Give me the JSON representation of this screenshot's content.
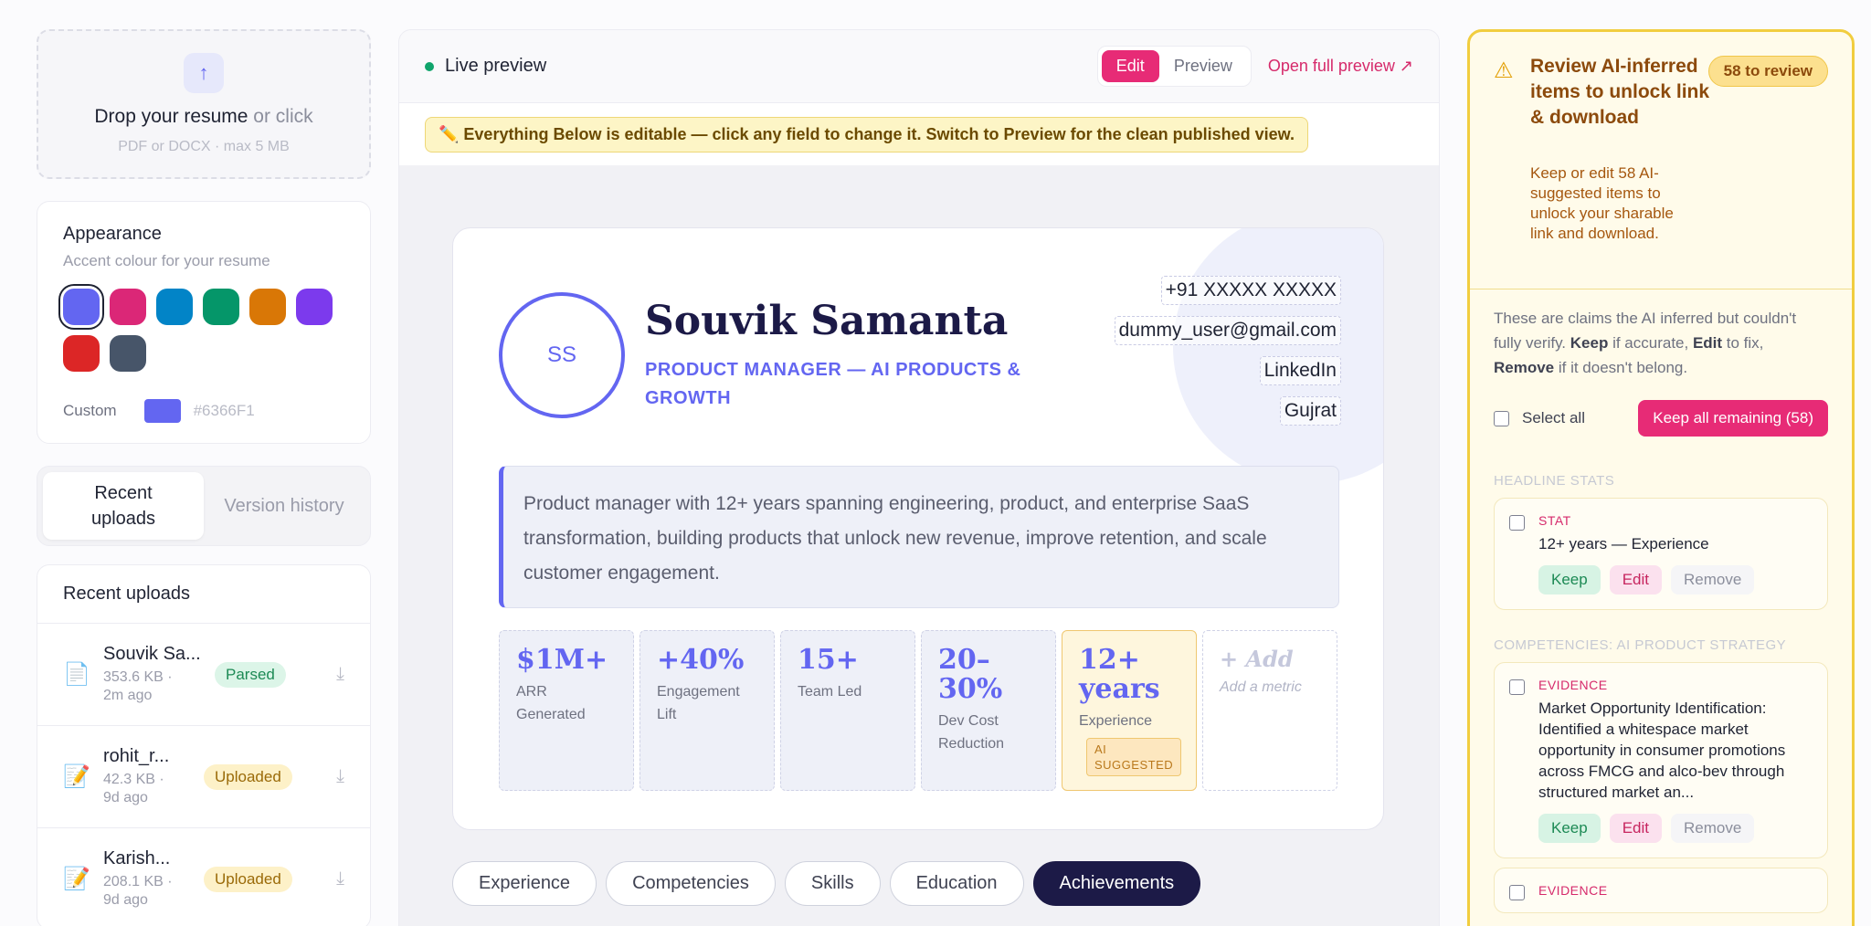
{
  "upload": {
    "icon": "arrow-up-icon",
    "title": "Drop your resume",
    "title_suffix": " or click",
    "subtitle": "PDF or DOCX · max 5 MB"
  },
  "appearance": {
    "title": "Appearance",
    "subtitle": "Accent colour for your resume",
    "swatches": [
      "#6366F1",
      "#DB2777",
      "#0284C7",
      "#059669",
      "#D97706",
      "#7C3AED",
      "#DC2626",
      "#475569"
    ],
    "selected": "#6366F1",
    "custom_label": "Custom",
    "custom_value": "#6366F1"
  },
  "side_tabs": [
    {
      "label": "Recent\nuploads",
      "active": true
    },
    {
      "label": "Version history",
      "active": false
    }
  ],
  "uploads": {
    "title": "Recent uploads",
    "items": [
      {
        "name": "Souvik Sa...",
        "size": "353.6 KB ·",
        "time": "2m ago",
        "status": "Parsed"
      },
      {
        "name": "rohit_r...",
        "size": "42.3 KB ·",
        "time": "9d ago",
        "status": "Uploaded"
      },
      {
        "name": "Karish...",
        "size": "208.1 KB ·",
        "time": "9d ago",
        "status": "Uploaded"
      }
    ]
  },
  "preview_bar": {
    "live_label": "Live preview",
    "edit_label": "Edit",
    "preview_label": "Preview",
    "open_full_label": "Open full preview ↗"
  },
  "notice": "✏️ Everything Below is editable — click any field to change it. Switch to Preview for the clean published view.",
  "resume": {
    "initials": "SS",
    "name": "Souvik Samanta",
    "title": "PRODUCT MANAGER — AI PRODUCTS & GROWTH",
    "contacts": [
      "+91 XXXXX XXXXX",
      "dummy_user@gmail.com",
      "LinkedIn",
      "Gujrat"
    ],
    "summary": "Product manager with 12+ years spanning engineering, product, and enterprise SaaS transformation, building products that unlock new revenue, improve retention, and scale customer engagement.",
    "metrics": [
      {
        "value": "$1M+",
        "label": "ARR Generated"
      },
      {
        "value": "+40%",
        "label": "Engagement Lift"
      },
      {
        "value": "15+",
        "label": "Team Led"
      },
      {
        "value": "20–30%",
        "label": "Dev Cost Reduction"
      },
      {
        "value": "12+ years",
        "label": "Experience",
        "tag": "AI SUGGESTED"
      }
    ],
    "add_metric": {
      "value": "+ Add",
      "label": "Add a metric"
    }
  },
  "section_tabs": [
    "Experience",
    "Competencies",
    "Skills",
    "Education",
    "Achievements"
  ],
  "active_section": "Achievements",
  "review": {
    "title": "Review AI-inferred items to unlock link & download",
    "description": "Keep or edit 58 AI-suggested items to unlock your sharable link and download.",
    "count_badge": "58 to review",
    "intro_1": "These are claims the AI inferred but couldn't fully verify. ",
    "intro_keep": "Keep",
    "intro_2": " if accurate, ",
    "intro_edit": "Edit",
    "intro_3": " to fix, ",
    "intro_remove": "Remove",
    "intro_4": " if it doesn't belong.",
    "select_all": "Select all",
    "keep_all": "Keep all remaining (58)",
    "groups": [
      {
        "label": "HEADLINE STATS",
        "items": [
          {
            "kind": "STAT",
            "text": "12+ years — Experience"
          }
        ]
      },
      {
        "label": "COMPETENCIES: AI PRODUCT STRATEGY",
        "items": [
          {
            "kind": "EVIDENCE",
            "text": "Market Opportunity Identification: Identified a whitespace market opportunity in consumer promotions across FMCG and alco-bev through structured market an..."
          },
          {
            "kind": "EVIDENCE",
            "text": ""
          }
        ]
      }
    ],
    "keep_label": "Keep",
    "edit_label": "Edit",
    "remove_label": "Remove"
  }
}
